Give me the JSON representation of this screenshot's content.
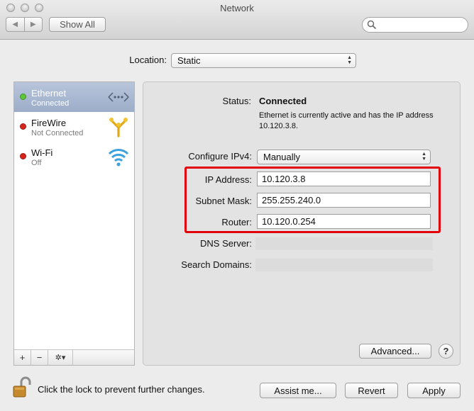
{
  "window": {
    "title": "Network"
  },
  "toolbar": {
    "back_glyph": "◀",
    "forward_glyph": "▶",
    "show_all_label": "Show All",
    "search_placeholder": ""
  },
  "location": {
    "label": "Location:",
    "value": "Static"
  },
  "services": [
    {
      "name": "Ethernet",
      "status": "Connected",
      "status_color": "#5fc53a",
      "icon": "ethernet-icon",
      "selected": true
    },
    {
      "name": "FireWire",
      "status": "Not Connected",
      "status_color": "#d8241c",
      "icon": "firewire-icon",
      "selected": false
    },
    {
      "name": "Wi-Fi",
      "status": "Off",
      "status_color": "#d8241c",
      "icon": "wifi-icon",
      "selected": false
    }
  ],
  "sidebar_toolbar": {
    "add": "+",
    "remove": "−",
    "gear": "✲▾"
  },
  "detail": {
    "status_label": "Status:",
    "status_value": "Connected",
    "status_description": "Ethernet is currently active and has the IP address 10.120.3.8.",
    "configure_label": "Configure IPv4:",
    "configure_value": "Manually",
    "ip_label": "IP Address:",
    "ip_value": "10.120.3.8",
    "subnet_label": "Subnet Mask:",
    "subnet_value": "255.255.240.0",
    "router_label": "Router:",
    "router_value": "10.120.0.254",
    "dns_label": "DNS Server:",
    "search_domains_label": "Search Domains:",
    "advanced_label": "Advanced...",
    "help_label": "?"
  },
  "footer": {
    "lock_text": "Click the lock to prevent further changes.",
    "assist_label": "Assist me...",
    "revert_label": "Revert",
    "apply_label": "Apply"
  },
  "colors": {
    "highlight_box": "#e2000b",
    "selection": "#a9b8d2",
    "connected_dot": "#5fc53a",
    "disconnected_dot": "#d8241c"
  }
}
